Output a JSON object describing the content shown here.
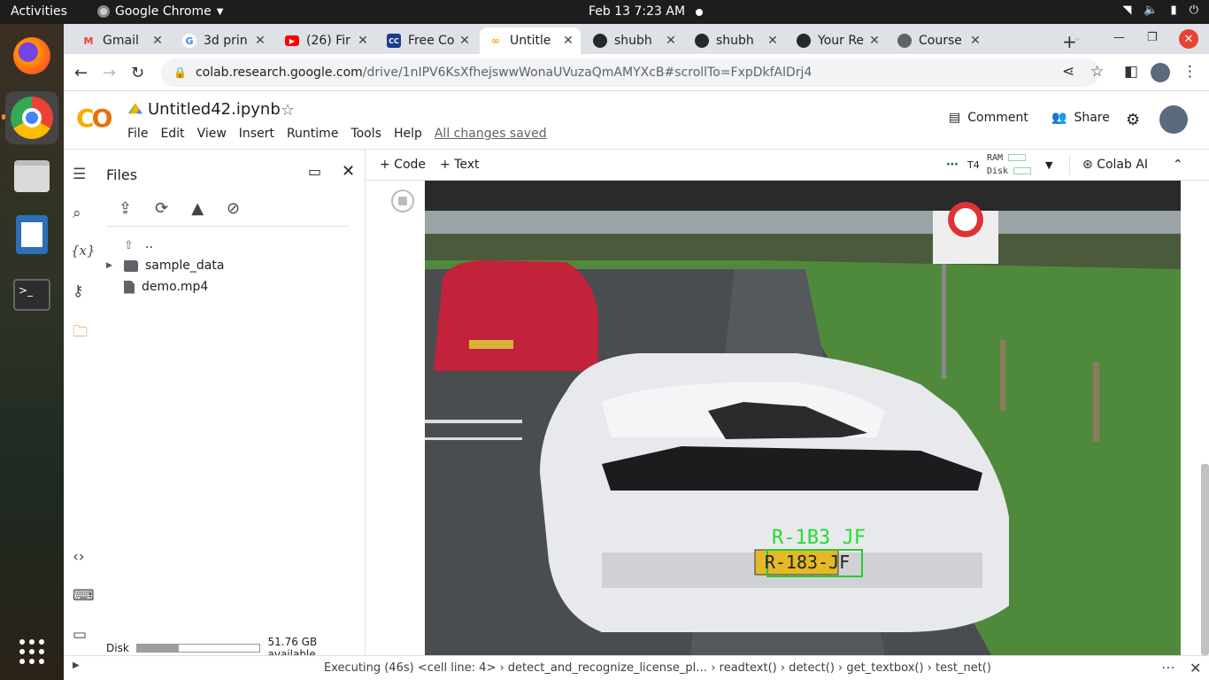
{
  "system": {
    "activities": "Activities",
    "app_name": "Google Chrome",
    "clock": "Feb 13  7:23 AM"
  },
  "tabs": [
    {
      "title": "Gmail",
      "icon": "gmail-icon",
      "color": "#ea4335"
    },
    {
      "title": "3d prin",
      "icon": "google-icon",
      "color": "#4285f4"
    },
    {
      "title": "(26) Fir",
      "icon": "youtube-icon",
      "color": "#ff0000"
    },
    {
      "title": "Free Co",
      "icon": "freecode-icon",
      "color": "#1a3b8f"
    },
    {
      "title": "Untitle",
      "icon": "colab-icon",
      "color": "#f9ab00",
      "active": true
    },
    {
      "title": "shubh",
      "icon": "github-icon",
      "color": "#24292e"
    },
    {
      "title": "shubh",
      "icon": "github-icon",
      "color": "#24292e"
    },
    {
      "title": "Your Re",
      "icon": "github-icon",
      "color": "#24292e"
    },
    {
      "title": "Course",
      "icon": "globe-icon",
      "color": "#5f6368"
    }
  ],
  "url": {
    "host": "colab.research.google.com",
    "path": "/drive/1nIPV6KsXfhejswwWonaUVuzaQmAMYXcB#scrollTo=FxpDkfAlDrj4"
  },
  "notebook": {
    "filename": "Untitled42.ipynb",
    "menu": [
      "File",
      "Edit",
      "View",
      "Insert",
      "Runtime",
      "Tools",
      "Help"
    ],
    "saved_status": "All changes saved",
    "comment_label": "Comment",
    "share_label": "Share"
  },
  "files_panel": {
    "title": "Files",
    "items": [
      {
        "name": "..",
        "type": "updir"
      },
      {
        "name": "sample_data",
        "type": "folder"
      },
      {
        "name": "demo.mp4",
        "type": "file"
      }
    ],
    "disk_label": "Disk",
    "disk_available": "51.76 GB available",
    "disk_used_fraction": 0.34
  },
  "toolbar": {
    "code_label": "+ Code",
    "text_label": "+ Text",
    "runtime": "T4",
    "ram_label": "RAM",
    "disk_label": "Disk",
    "colab_ai_label": "Colab AI"
  },
  "video": {
    "detected_text": "R-1B3 JF",
    "plate_text": "R-183-JF"
  },
  "status": {
    "text": "Executing (46s) <cell line: 4> › detect_and_recognize_license_pl… › readtext() › detect() › get_textbox() › test_net()"
  }
}
